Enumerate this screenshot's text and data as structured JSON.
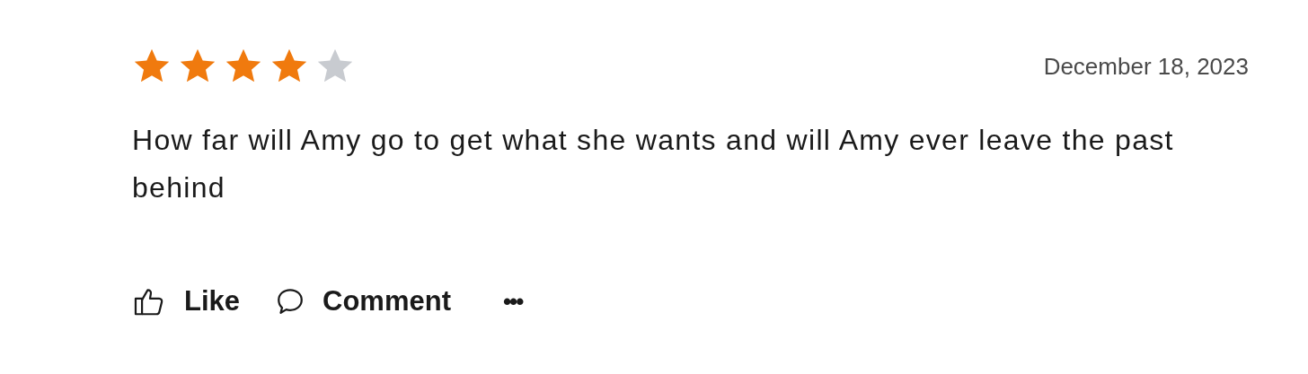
{
  "review": {
    "stars": 4,
    "date": "December 18, 2023",
    "text": "How far will Amy go to get what she wants and will Amy ever leave the past behind"
  },
  "actions": [
    {
      "kind": "like",
      "label": "Like"
    },
    {
      "kind": "comment",
      "label": "Comment"
    },
    {
      "kind": "more",
      "label": "•••"
    }
  ]
}
